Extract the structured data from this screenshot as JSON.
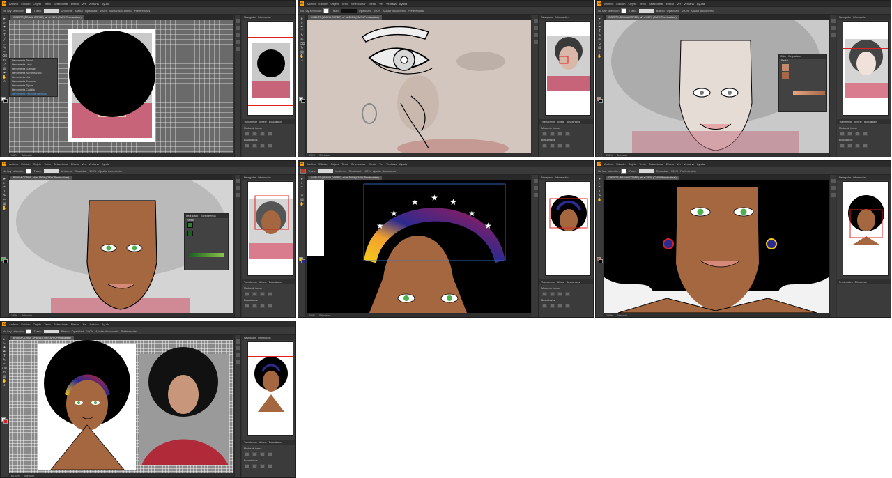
{
  "app": {
    "logo": "Ai",
    "menu": [
      "Archivo",
      "Edición",
      "Objeto",
      "Texto",
      "Seleccionar",
      "Efecto",
      "Ver",
      "Ventana",
      "Ayuda"
    ]
  },
  "control": {
    "no_selection": "No hay selección",
    "stroke": "Trazo:",
    "uniform": "Uniforme",
    "basic": "Básico",
    "opacity": "Opacidad:",
    "opacity_value": "100%",
    "style": "Estilo:",
    "doc_setup": "Ajustar documento",
    "prefs": "Preferencias"
  },
  "docs": {
    "w1": "GISELTS (BRAVIA CORBE) .ai* al 150% (CMYK/Previsualizar)",
    "w2": "GISELTS (BRAVIA CORBE) .ai* al 600% (CMYK/Previsualizar)",
    "w3": "GISELTS (BRAVIA CORBE) .ai* al 200% (CMYK/Previsualizar)",
    "w4": "BRAVIA CORBE .ai* al 150% (CMYK/Previsualizar)",
    "w5": "GISELTS (BRAVIA CORBE) .ai* al 300% (CMYK/Previsualizar)",
    "w6": "GISELTS (BRAVIA CORBE) .ai* al 250% (CMYK/Previsualizar)",
    "w7": "BRAVIA CORBE .ai* al 66,67% (CMYK/Previsualizar)"
  },
  "status": {
    "zoom1": "150%",
    "zoom2": "600%",
    "zoom3": "200%",
    "zoom4": "150%",
    "zoom5": "300%",
    "zoom6": "250%",
    "zoom7": "66,67%",
    "mode": "Selección"
  },
  "panels": {
    "navigator": "Navegador",
    "info": "Información",
    "transform": "Transformar",
    "align": "Alinear",
    "pathfinder": "Buscatrazos",
    "shape_modes": "Modos de forma:",
    "pathfinders": "Buscatrazos:",
    "properties": "Propiedades",
    "libraries": "Bibliotecas"
  },
  "w1_menu": [
    "Herramienta Pincel",
    "Herramienta Lápiz",
    "Herramienta Suavizar",
    "Herramienta Borrar trazado",
    "Herramienta Unir",
    "Herramienta Borrador",
    "Herramienta Tijeras",
    "Herramienta Cuchilla",
    "Herramienta Pincel de manchas"
  ],
  "gradient_panel": {
    "title": "Degradado",
    "tab2": "Color",
    "tab3": "Transparencia",
    "type": "Tipo:",
    "type_value": "Radial",
    "angle": "0°",
    "opacity": "Opacidad:",
    "location": "Ubicación:"
  },
  "colors": {
    "skin": "#a5673f",
    "skin_light": "#c58557",
    "hair": "#000000",
    "eye": "#4caf50",
    "shirt": "#c0394b",
    "accent": "#ff9a00",
    "star_band_purple": "#2c2a8f",
    "star_band_red": "#d4242a",
    "star_band_yellow": "#f6cc19"
  }
}
